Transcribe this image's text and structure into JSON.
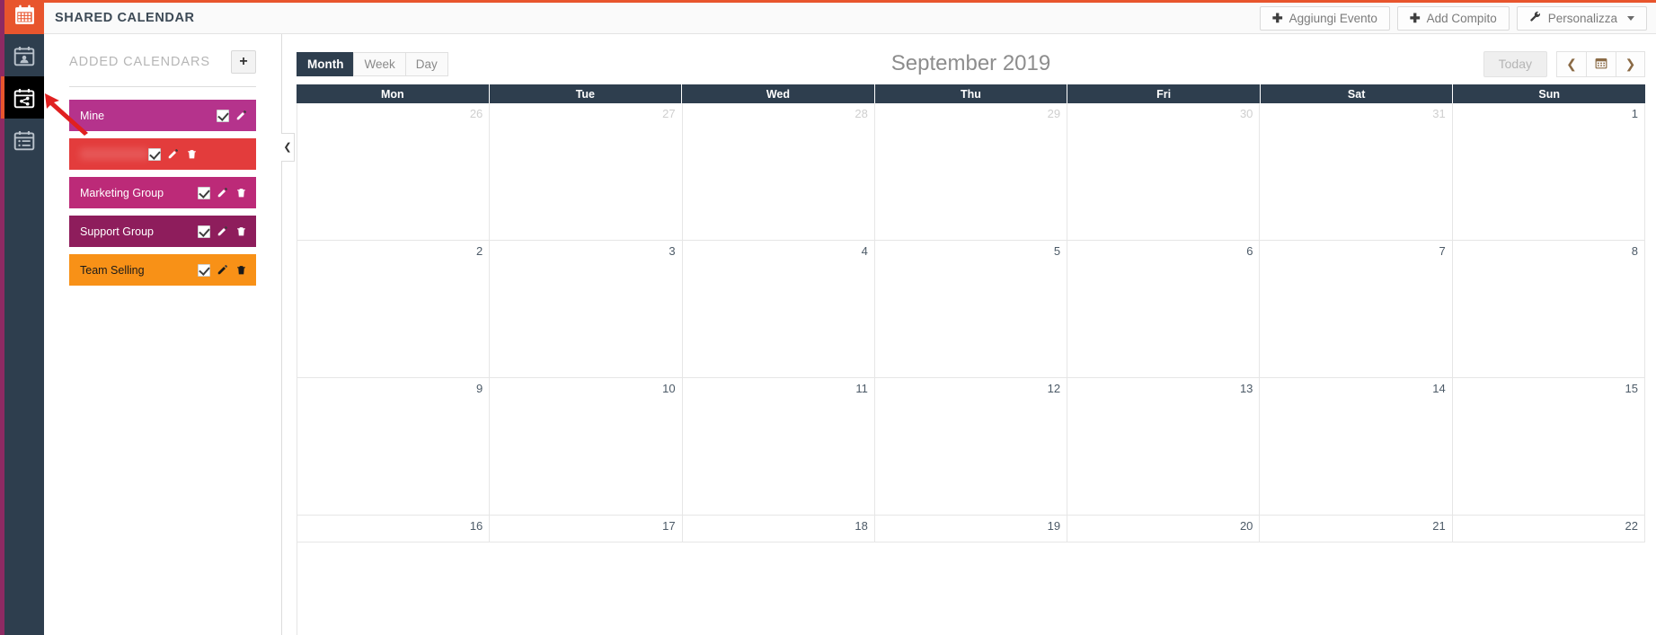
{
  "topbar": {
    "title": "SHARED CALENDAR",
    "brand_icon": "calendar-icon",
    "actions": [
      {
        "label": "Aggiungi Evento",
        "icon": "plus-icon",
        "name": "add-event-button"
      },
      {
        "label": "Add Compito",
        "icon": "plus-icon",
        "name": "add-task-button"
      },
      {
        "label": "Personalizza",
        "icon": "wrench-icon",
        "name": "customize-button",
        "caret": true
      }
    ]
  },
  "rail": {
    "items": [
      {
        "icon": "calendar-person-icon",
        "name": "rail-my-calendar",
        "active": false
      },
      {
        "icon": "calendar-share-icon",
        "name": "rail-shared-calendar",
        "active": true
      },
      {
        "icon": "calendar-list-icon",
        "name": "rail-calendar-list",
        "active": false
      }
    ]
  },
  "left_panel": {
    "title": "ADDED CALENDARS",
    "add_button_label": "+",
    "calendars": [
      {
        "label": "Mine",
        "color": "#b5338c",
        "checked": true,
        "edit": true,
        "delete": false,
        "redacted": false,
        "text_color": "#ffffff"
      },
      {
        "label": "",
        "color": "#e33c3c",
        "checked": true,
        "edit": true,
        "delete": true,
        "redacted": true,
        "text_color": "#ffffff"
      },
      {
        "label": "Marketing Group",
        "color": "#bc2a78",
        "checked": true,
        "edit": true,
        "delete": true,
        "redacted": false,
        "text_color": "#ffffff"
      },
      {
        "label": "Support Group",
        "color": "#8e1d5c",
        "checked": true,
        "edit": true,
        "delete": true,
        "redacted": false,
        "text_color": "#ffffff"
      },
      {
        "label": "Team Selling",
        "color": "#f89117",
        "checked": true,
        "edit": true,
        "delete": true,
        "redacted": false,
        "text_color": "#1a1a1a"
      }
    ],
    "collapse_glyph": "❮"
  },
  "calendar": {
    "views": [
      {
        "label": "Month",
        "active": true
      },
      {
        "label": "Week",
        "active": false
      },
      {
        "label": "Day",
        "active": false
      }
    ],
    "month_label": "September 2019",
    "today_label": "Today",
    "nav": {
      "prev_glyph": "‹",
      "picker_glyph": "Ὄ5",
      "next_glyph": "›"
    },
    "day_headers": [
      "Mon",
      "Tue",
      "Wed",
      "Thu",
      "Fri",
      "Sat",
      "Sun"
    ],
    "weeks": [
      [
        {
          "n": "26",
          "other": true
        },
        {
          "n": "27",
          "other": true
        },
        {
          "n": "28",
          "other": true
        },
        {
          "n": "29",
          "other": true
        },
        {
          "n": "30",
          "other": true
        },
        {
          "n": "31",
          "other": true
        },
        {
          "n": "1",
          "other": false
        }
      ],
      [
        {
          "n": "2",
          "other": false
        },
        {
          "n": "3",
          "other": false
        },
        {
          "n": "4",
          "other": false
        },
        {
          "n": "5",
          "other": false
        },
        {
          "n": "6",
          "other": false
        },
        {
          "n": "7",
          "other": false
        },
        {
          "n": "8",
          "other": false
        }
      ],
      [
        {
          "n": "9",
          "other": false
        },
        {
          "n": "10",
          "other": false
        },
        {
          "n": "11",
          "other": false
        },
        {
          "n": "12",
          "other": false
        },
        {
          "n": "13",
          "other": false
        },
        {
          "n": "14",
          "other": false
        },
        {
          "n": "15",
          "other": false
        }
      ],
      [
        {
          "n": "16",
          "other": false
        },
        {
          "n": "17",
          "other": false
        },
        {
          "n": "18",
          "other": false
        },
        {
          "n": "19",
          "other": false
        },
        {
          "n": "20",
          "other": false
        },
        {
          "n": "21",
          "other": false
        },
        {
          "n": "22",
          "other": false
        }
      ]
    ]
  },
  "annotation": {
    "arrow_color": "#e02020",
    "arrow_target": "rail-shared-calendar"
  },
  "colors": {
    "accent": "#e8552d",
    "dark": "#2e3e4e",
    "rail_edge": "#8e2a63"
  }
}
